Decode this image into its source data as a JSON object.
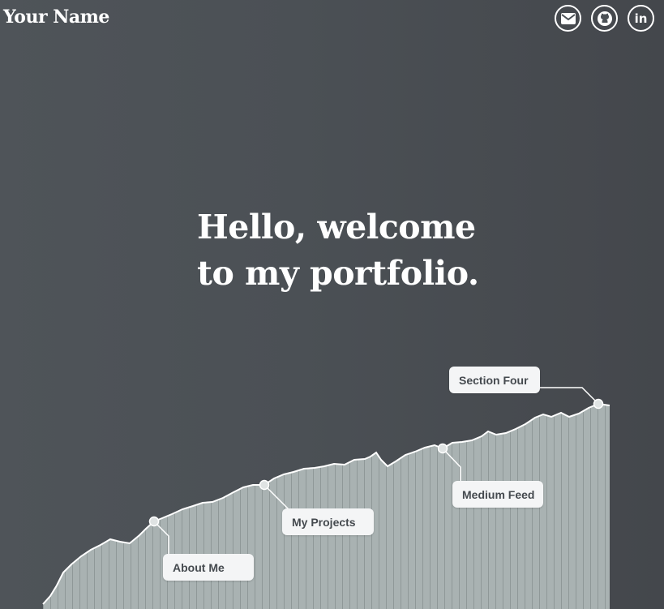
{
  "header": {
    "brand": "Your Name",
    "social": [
      {
        "name": "email-icon"
      },
      {
        "name": "github-icon"
      },
      {
        "name": "linkedin-icon",
        "text": "in"
      }
    ]
  },
  "hero": {
    "line1": "Hello, welcome",
    "line2": "to my portfolio."
  },
  "sections": {
    "about": "About Me",
    "projects": "My Projects",
    "medium": "Medium Feed",
    "four": "Section Four"
  },
  "colors": {
    "background": "#4b5055",
    "chart_fill": "#a9b2b2",
    "line": "#ffffff",
    "label_bg": "#f4f5f6",
    "label_text": "#454a4f"
  }
}
